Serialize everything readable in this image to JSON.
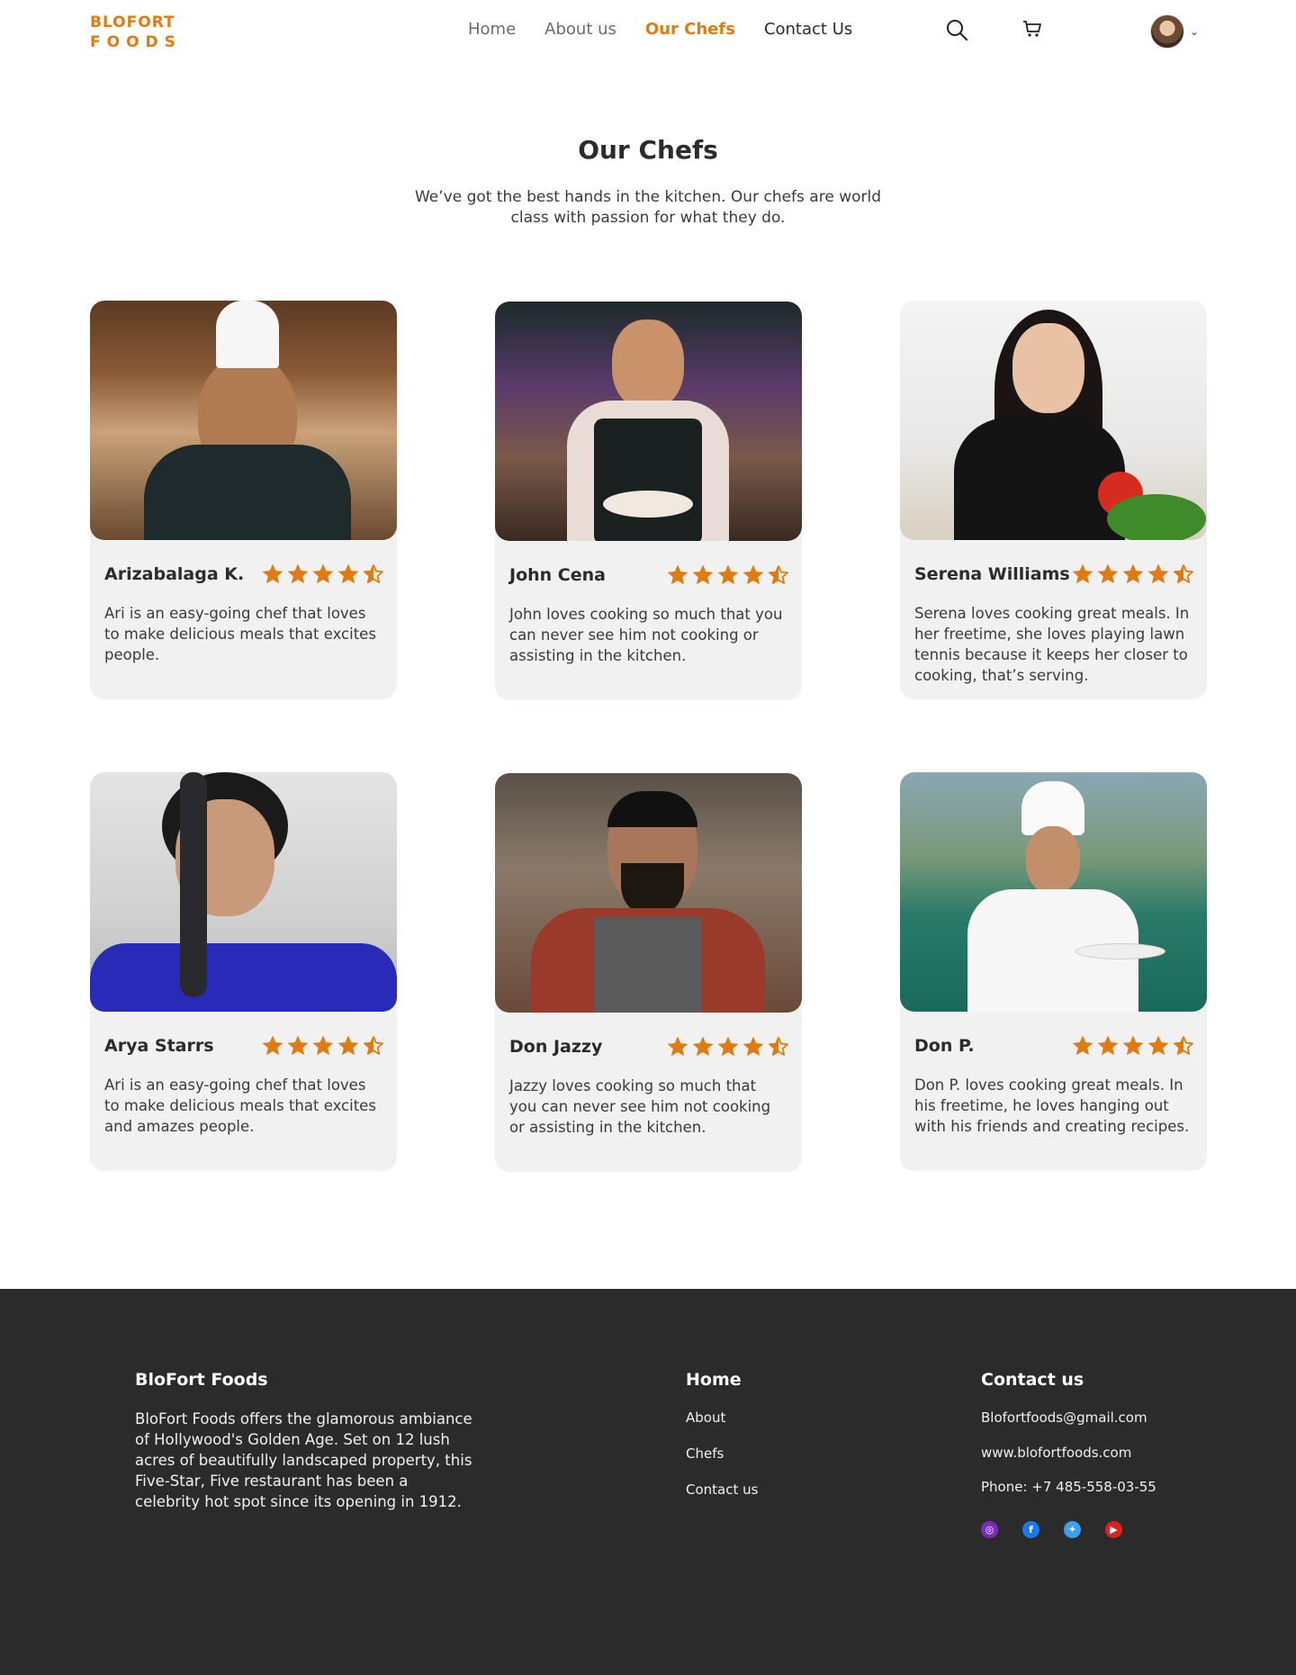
{
  "header": {
    "logo_line1": "BLOFORT",
    "logo_line2": "FOODS",
    "nav": [
      {
        "label": "Home"
      },
      {
        "label": "About us"
      },
      {
        "label": "Our Chefs"
      },
      {
        "label": "Contact Us"
      }
    ],
    "active_nav": "Our Chefs",
    "icons": [
      "search-icon",
      "cart-icon",
      "chevron-down-icon"
    ]
  },
  "hero": {
    "title": "Our Chefs",
    "subtitle": "We’ve got the best hands in the kitchen. Our chefs are world class with passion for what they do."
  },
  "rating": {
    "stars": 4.5,
    "max": 5
  },
  "chefs": [
    {
      "name": "Arizabalaga K.",
      "desc": "Ari is an easy-going chef that loves to make delicious meals that excites people."
    },
    {
      "name": "John Cena",
      "desc": "John loves cooking so much that you can never see him not cooking or assisting in the kitchen."
    },
    {
      "name": "Serena Williams",
      "desc": "Serena loves cooking great meals. In her freetime, she loves playing lawn tennis because it keeps her closer to cooking, that’s serving."
    },
    {
      "name": "Arya Starrs",
      "desc": "Ari is an easy-going chef that loves to make delicious meals that excites and amazes people."
    },
    {
      "name": "Don Jazzy",
      "desc": "Jazzy loves cooking so much that you can never see him not cooking or assisting in the kitchen."
    },
    {
      "name": "Don P.",
      "desc": "Don P. loves cooking great meals. In his freetime, he loves hanging out with his friends and creating recipes."
    }
  ],
  "footer": {
    "brand_title": "BloFort Foods",
    "brand_text": "BloFort Foods offers the glamorous ambiance of Hollywood's Golden Age. Set on 12 lush acres of beautifully landscaped property, this Five-Star, Five restaurant has been a celebrity hot spot since its opening in 1912.",
    "nav_title": "Home",
    "nav_links": [
      "About",
      "Chefs",
      "Contact us"
    ],
    "contact_title": "Contact us",
    "email": "Blofortfoods@gmail.com",
    "website": "www.blofortfoods.com",
    "phone": "Phone: +7 485-558-03-55",
    "social": [
      "instagram-icon",
      "facebook-icon",
      "twitter-icon",
      "youtube-icon"
    ]
  },
  "colors": {
    "accent": "#e07b12",
    "footer_bg": "#2b2b2b",
    "card_bg": "#f1f1f1"
  }
}
